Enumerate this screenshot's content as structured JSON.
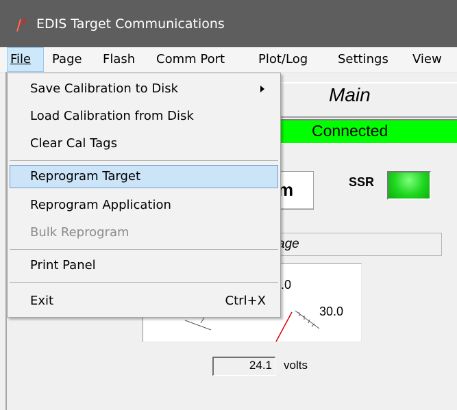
{
  "window": {
    "title": "EDIS Target Communications"
  },
  "menubar": {
    "items": [
      "File",
      "Page",
      "Flash",
      "Comm Port",
      "Plot/Log",
      "Settings",
      "View"
    ]
  },
  "file_menu": {
    "items": [
      {
        "label": "Save Calibration to Disk",
        "submenu": true
      },
      {
        "label": "Load Calibration from Disk"
      },
      {
        "label": "Clear Cal Tags"
      },
      {
        "label": "Reprogram Target",
        "highlighted": true
      },
      {
        "label": "Reprogram Application"
      },
      {
        "label": "Bulk Reprogram",
        "disabled": true
      },
      {
        "label": "Print Panel"
      },
      {
        "label": "Exit",
        "shortcut": "Ctrl+X"
      }
    ]
  },
  "panel": {
    "title": "Main",
    "status": "Connected",
    "mode_fragment": "m",
    "ssr_label": "SSR",
    "section_fragment": "age",
    "gauge": {
      "top_label_fragment": ".0",
      "right_label": "30.0"
    },
    "readout": {
      "value": "24.1",
      "unit": "volts"
    }
  },
  "colors": {
    "titlebar": "#5e5e5e",
    "status_on": "#00ff00",
    "ssr_led": "#1ed61e",
    "highlight": "#cce4f7",
    "needle": "#e00000"
  }
}
